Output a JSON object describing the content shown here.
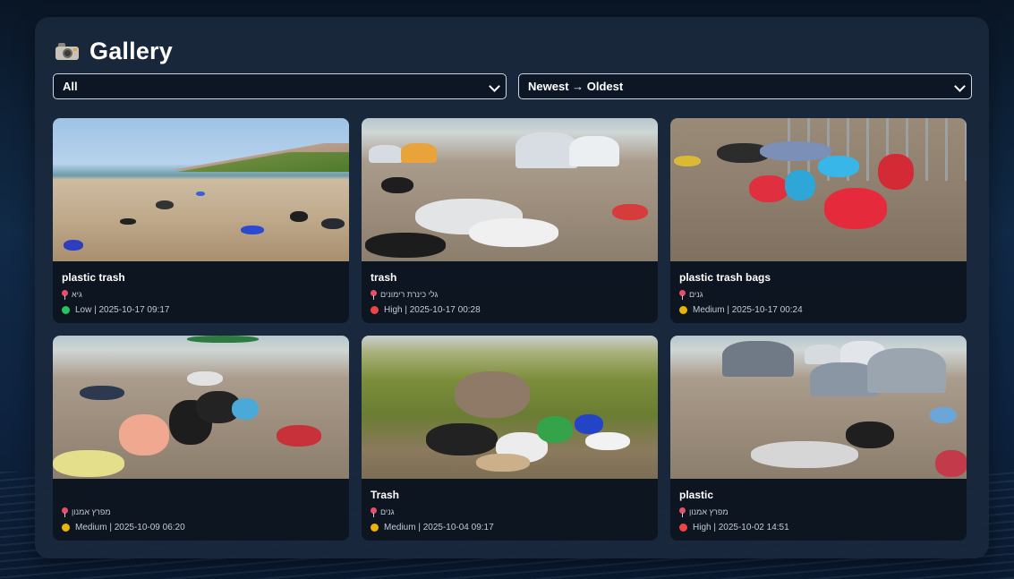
{
  "header": {
    "title": "Gallery",
    "icon": "camera-icon"
  },
  "filters": {
    "category_selected": "All",
    "sort_selected": "Newest → Oldest"
  },
  "severity_colors": {
    "Low": "#22c55e",
    "Medium": "#eab308",
    "High": "#ef4444"
  },
  "cards": [
    {
      "caption": "plastic trash",
      "location": "גיא",
      "severity": "Low",
      "meta": "Low | 2025-10-17 09:17"
    },
    {
      "caption": "trash",
      "location": "גלי כינרת רימונים",
      "severity": "High",
      "meta": "High | 2025-10-17 00:28"
    },
    {
      "caption": "plastic trash bags",
      "location": "גנים",
      "severity": "Medium",
      "meta": "Medium | 2025-10-17 00:24"
    },
    {
      "caption": "",
      "location": "מפרץ אמנון",
      "severity": "Medium",
      "meta": "Medium | 2025-10-09 06:20"
    },
    {
      "caption": "Trash",
      "location": "גנים",
      "severity": "Medium",
      "meta": "Medium | 2025-10-04 09:17"
    },
    {
      "caption": "plastic",
      "location": "מפרץ אמנון",
      "severity": "High",
      "meta": "High | 2025-10-02 14:51"
    }
  ]
}
